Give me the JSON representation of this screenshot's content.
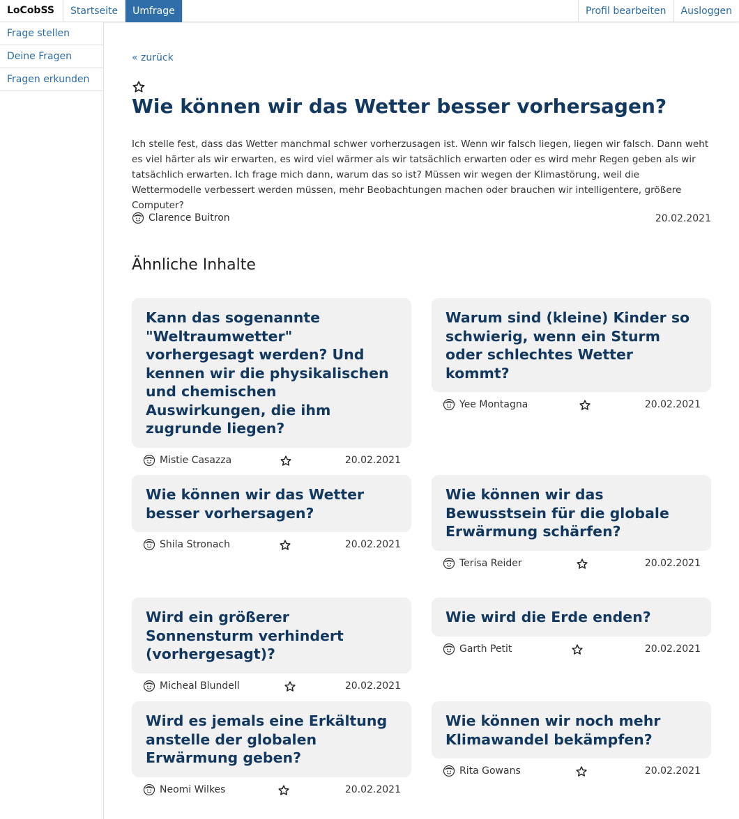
{
  "topbar": {
    "brand": "LoCobSS",
    "nav_left": [
      "Startseite",
      "Umfrage"
    ],
    "active_nav": "Umfrage",
    "nav_right": [
      "Profil bearbeiten",
      "Ausloggen"
    ]
  },
  "sidebar": {
    "items": [
      {
        "label": "Frage stellen"
      },
      {
        "label": "Deine Fragen"
      },
      {
        "label": "Fragen erkunden"
      }
    ]
  },
  "main": {
    "back_label": "« zurück",
    "title": "Wie können wir das Wetter besser vorhersagen?",
    "body": "Ich stelle fest, dass das Wetter manchmal schwer vorherzusagen ist. Wenn wir falsch liegen, liegen wir falsch. Dann weht es viel härter als wir erwarten, es wird viel wärmer als wir tatsächlich erwarten oder es wird mehr Regen geben als wir tatsächlich erwarten. Ich frage mich dann, warum das so ist? Müssen wir wegen der Klimastörung, weil die Wettermodelle verbessert werden müssen, mehr Beobachtungen machen oder brauchen wir intelligentere, größere Computer?",
    "author": "Clarence Buitron",
    "date": "20.02.2021",
    "similar_heading": "Ähnliche Inhalte"
  },
  "cards": [
    {
      "title": "Kann das sogenannte \"Weltraumwetter\" vorhergesagt werden? Und kennen wir die physikalischen und chemischen Auswirkungen, die ihm zugrunde liegen?",
      "author": "Mistie Casazza",
      "date": "20.02.2021"
    },
    {
      "title": "Warum sind (kleine) Kinder so schwierig, wenn ein Sturm oder schlechtes Wetter kommt?",
      "author": "Yee Montagna",
      "date": "20.02.2021"
    },
    {
      "title": "Wie können wir das Wetter besser vorhersagen?",
      "author": "Shila Stronach",
      "date": "20.02.2021"
    },
    {
      "title": "Wie können wir das Bewusstsein für die globale Erwärmung schärfen?",
      "author": "Terisa Reider",
      "date": "20.02.2021"
    },
    {
      "title": "Wird ein größerer Sonnensturm verhindert (vorhergesagt)?",
      "author": "Micheal Blundell",
      "date": "20.02.2021"
    },
    {
      "title": "Wie wird die Erde enden?",
      "author": "Garth Petit",
      "date": "20.02.2021"
    },
    {
      "title": "Wird es jemals eine Erkältung anstelle der globalen Erwärmung geben?",
      "author": "Neomi Wilkes",
      "date": "20.02.2021"
    },
    {
      "title": "Wie können wir noch mehr Klimawandel bekämpfen?",
      "author": "Rita Gowans",
      "date": "20.02.2021"
    }
  ],
  "colors": {
    "accent": "#2f6ea8",
    "title": "#12385f",
    "card_bg": "#f1f1f1"
  }
}
